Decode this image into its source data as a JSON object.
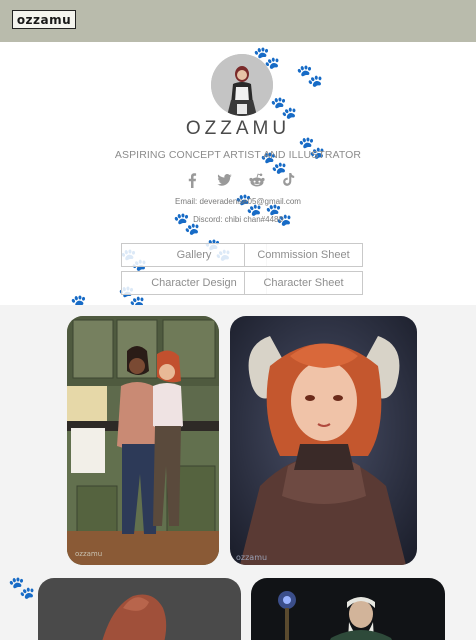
{
  "header": {
    "logo_text": "ozzamu"
  },
  "profile": {
    "name": "OZZAMU",
    "tagline": "ASPIRING CONCEPT ARTIST AND ILLUSTRATOR",
    "email_line": "Email: deveradenise05@gmail.com",
    "discord_line": "Discord: chibi chan#4480"
  },
  "socials": [
    {
      "name": "facebook-icon"
    },
    {
      "name": "twitter-icon"
    },
    {
      "name": "reddit-icon"
    },
    {
      "name": "tiktok-icon"
    }
  ],
  "nav": {
    "gallery": "Gallery",
    "commission_sheet": "Commission Sheet",
    "character_design": "Character Design",
    "character_sheet": "Character Sheet"
  },
  "gallery": {
    "watermark": "ozzamu"
  },
  "colors": {
    "topbar": "#b9bbac",
    "gallery_background": "#f3f3f3",
    "button_border": "#c9c9c9"
  }
}
